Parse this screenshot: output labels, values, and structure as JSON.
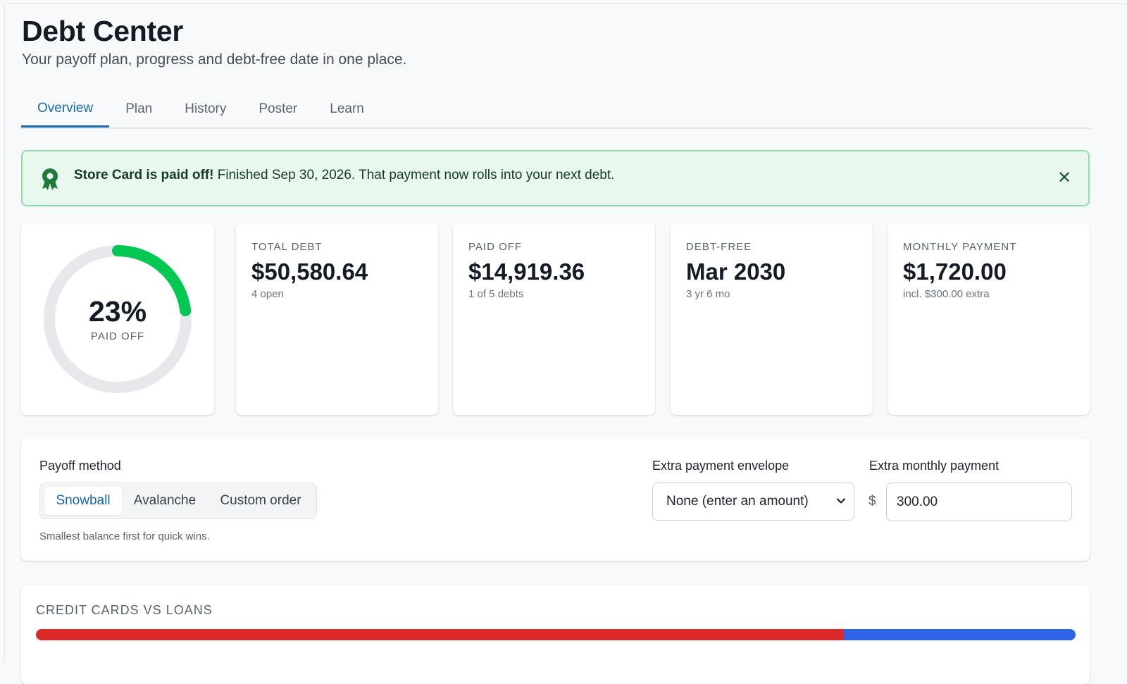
{
  "header": {
    "title": "Debt Center",
    "subtitle": "Your payoff plan, progress and debt-free date in one place."
  },
  "tabs": [
    {
      "label": "Overview",
      "active": true
    },
    {
      "label": "Plan"
    },
    {
      "label": "History"
    },
    {
      "label": "Poster"
    },
    {
      "label": "Learn"
    }
  ],
  "banner": {
    "icon": "award-ribbon-icon",
    "headline": "Store Card is paid off!",
    "message": "Finished Sep 30, 2026. That payment now rolls into your next debt.",
    "close_icon": "close-icon"
  },
  "progress": {
    "percent_label": "23%",
    "caption": "PAID OFF",
    "fraction": 0.23
  },
  "stats": {
    "total_debt": {
      "label": "TOTAL DEBT",
      "value": "$50,580.64",
      "sub": "4 open"
    },
    "paid_off": {
      "label": "PAID OFF",
      "value": "$14,919.36",
      "sub": "1 of 5 debts"
    },
    "debt_free": {
      "label": "DEBT-FREE",
      "value": "Mar 2030",
      "sub": "3 yr 6 mo"
    },
    "monthly_payment": {
      "label": "MONTHLY PAYMENT",
      "value": "$1,720.00",
      "sub": "incl. $300.00 extra"
    }
  },
  "controls": {
    "method_label": "Payoff method",
    "methods": [
      "Snowball",
      "Avalanche",
      "Custom order"
    ],
    "selected_method": "Snowball",
    "method_hint": "Smallest balance first for quick wins.",
    "envelope_label": "Extra payment envelope",
    "envelope_value": "None (enter an amount)",
    "extra_label": "Extra monthly payment",
    "currency_symbol": "$",
    "extra_value": "300.00"
  },
  "breakdown": {
    "title": "CREDIT CARDS VS LOANS",
    "credit_cards_fraction": 0.777,
    "loans_fraction": 0.223,
    "colors": {
      "credit_cards": "#dc2a2a",
      "loans": "#2f62e6"
    }
  },
  "colors": {
    "accent": "#1869b0",
    "success": "#00c853",
    "banner_bg": "#e8f8ee"
  }
}
